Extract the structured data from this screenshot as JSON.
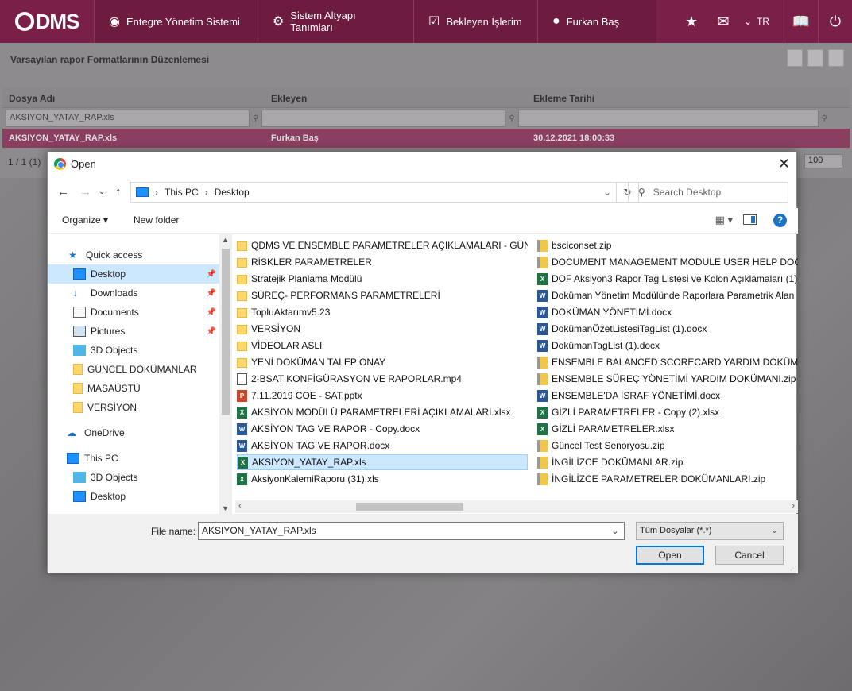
{
  "topbar": {
    "logo": "DMS",
    "nav": [
      {
        "label": "Entegre Yönetim Sistemi",
        "icon": "q-logo-icon"
      },
      {
        "label": "Sistem Altyapı Tanımları",
        "icon": "gear-icon"
      },
      {
        "label": "Bekleyen İşlerim",
        "icon": "clipboard-icon"
      },
      {
        "label": "Furkan Baş",
        "icon": "user-icon"
      }
    ],
    "lang": "TR",
    "accent": "#7a1f47"
  },
  "page": {
    "title": "Varsayılan rapor Formatlarının Düzenlemesi",
    "columns": [
      "Dosya Adı",
      "Ekleyen",
      "Ekleme Tarihi"
    ],
    "filter_value": "AKSIYON_YATAY_RAP.xls",
    "row": [
      "AKSIYON_YATAY_RAP.xls",
      "Furkan Baş",
      "30.12.2021 18:00:33"
    ],
    "pager": "1 / 1 (1)",
    "page_size": "100"
  },
  "dialog": {
    "title": "Open",
    "path": [
      "This PC",
      "Desktop"
    ],
    "search_placeholder": "Search Desktop",
    "organize": "Organize",
    "new_folder": "New folder",
    "nav": [
      {
        "label": "Quick access",
        "icon": "star-icon",
        "level": 0
      },
      {
        "label": "Desktop",
        "icon": "desktop-icon",
        "level": 1,
        "selected": true,
        "pinned": true
      },
      {
        "label": "Downloads",
        "icon": "download-icon",
        "level": 1,
        "pinned": true
      },
      {
        "label": "Documents",
        "icon": "documents-icon",
        "level": 1,
        "pinned": true
      },
      {
        "label": "Pictures",
        "icon": "pictures-icon",
        "level": 1,
        "pinned": true
      },
      {
        "label": "3D Objects",
        "icon": "3d-objects-icon",
        "level": 1
      },
      {
        "label": "GÜNCEL DOKÜMANLAR",
        "icon": "folder-icon",
        "level": 1
      },
      {
        "label": "MASAÜSTÜ",
        "icon": "folder-icon",
        "level": 1
      },
      {
        "label": "VERSİYON",
        "icon": "folder-icon",
        "level": 1
      },
      {
        "label": "OneDrive",
        "icon": "cloud-icon",
        "level": 0
      },
      {
        "label": "This PC",
        "icon": "pc-icon",
        "level": 0
      },
      {
        "label": "3D Objects",
        "icon": "3d-objects-icon",
        "level": 1
      },
      {
        "label": "Desktop",
        "icon": "desktop-icon",
        "level": 1
      }
    ],
    "files_col1": [
      {
        "name": "QDMS VE ENSEMBLE PARAMETRELER AÇIKLAMALARI - GÜNCEL",
        "type": "folder"
      },
      {
        "name": "RİSKLER PARAMETRELER",
        "type": "folder"
      },
      {
        "name": "Stratejik Planlama Modülü",
        "type": "folder"
      },
      {
        "name": "SÜREÇ- PERFORMANS PARAMETRELERİ",
        "type": "folder"
      },
      {
        "name": "TopluAktarımv5.23",
        "type": "folder"
      },
      {
        "name": "VERSİYON",
        "type": "folder"
      },
      {
        "name": "VİDEOLAR ASLI",
        "type": "folder"
      },
      {
        "name": "YENİ DOKÜMAN TALEP ONAY",
        "type": "folder"
      },
      {
        "name": "2-BSAT KONFİGÜRASYON VE RAPORLAR.mp4",
        "type": "mp4"
      },
      {
        "name": "7.11.2019 COE - SAT.pptx",
        "type": "ppt"
      },
      {
        "name": "AKSİYON MODÜLÜ PARAMETRELERİ AÇIKLAMALARI.xlsx",
        "type": "xls"
      },
      {
        "name": "AKSİYON TAG VE RAPOR - Copy.docx",
        "type": "doc"
      },
      {
        "name": "AKSİYON TAG VE RAPOR.docx",
        "type": "doc"
      },
      {
        "name": "AKSIYON_YATAY_RAP.xls",
        "type": "xls",
        "selected": true
      },
      {
        "name": "AksiyonKalemiRaporu (31).xls",
        "type": "xls"
      }
    ],
    "files_col2": [
      {
        "name": "bsciconset.zip",
        "type": "zip"
      },
      {
        "name": "DOCUMENT MANAGEMENT MODULE USER HELP DOCUM",
        "type": "zip"
      },
      {
        "name": "DOF Aksiyon3 Rapor Tag Listesi ve Kolon Açıklamaları (1).x",
        "type": "xls"
      },
      {
        "name": "Doküman Yönetim Modülünde Raporlara Parametrik Alan",
        "type": "doc"
      },
      {
        "name": "DOKÜMAN YÖNETİMİ.docx",
        "type": "doc"
      },
      {
        "name": "DokümanÖzetListesiTagList (1).docx",
        "type": "doc"
      },
      {
        "name": "DokümanTagList (1).docx",
        "type": "doc"
      },
      {
        "name": "ENSEMBLE BALANCED SCORECARD YARDIM DOKÜMANI_",
        "type": "zip"
      },
      {
        "name": "ENSEMBLE SÜREÇ YÖNETİMİ YARDIM DOKÜMANI.zip",
        "type": "zip"
      },
      {
        "name": "ENSEMBLE'DA İSRAF YÖNETİMİ.docx",
        "type": "doc"
      },
      {
        "name": "GİZLİ PARAMETRELER - Copy (2).xlsx",
        "type": "xls"
      },
      {
        "name": "GİZLİ PARAMETRELER.xlsx",
        "type": "xls"
      },
      {
        "name": "Güncel Test Senoryosu.zip",
        "type": "zip"
      },
      {
        "name": "İNGİLİZCE DOKÜMANLAR.zip",
        "type": "zip"
      },
      {
        "name": "İNGİLİZCE PARAMETRELER DOKÜMANLARI.zip",
        "type": "zip"
      }
    ],
    "file_name_label": "File name:",
    "file_name": "AKSIYON_YATAY_RAP.xls",
    "file_type": "Tüm Dosyalar (*.*)",
    "open_label": "Open",
    "cancel_label": "Cancel"
  }
}
